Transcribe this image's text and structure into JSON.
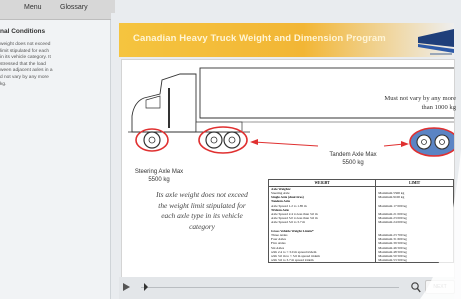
{
  "nav": {
    "tabs": [
      "Menu",
      "Glossary"
    ]
  },
  "sidebar": {
    "title": "nal Conditions",
    "lines": [
      "weight does not exceed",
      "limit stipulated for each",
      "in its vehicle category. It",
      "stressed that the load",
      "ween adjacent axles in a",
      "d not vary by any more",
      "kg."
    ]
  },
  "banner": {
    "title": "Canadian Heavy Truck Weight and Dimension Program"
  },
  "slide": {
    "callout_right": [
      "Must not vary by any more",
      "than 1000 kg"
    ],
    "tandem_label": [
      "Tandem Axle Max",
      "5500 kg"
    ],
    "steer_label": [
      "Steering Axle Max",
      "5500 kg"
    ],
    "body_note": [
      "Its axle weight does not exceed",
      "the weight limit stipulated for",
      "each axle type in its vehicle",
      "category"
    ],
    "table": {
      "headers": [
        "WEIGHT",
        "LIMIT"
      ],
      "rows": [
        [
          "Axle Weights:",
          ""
        ],
        [
          "Steering Axle",
          "Maximum 5500 kg"
        ],
        [
          "Single Axle (dual tires)",
          "Maximum 9100 kg"
        ],
        [
          "Tandem Axle",
          ""
        ],
        [
          "Axle Spread 1.2 to 1.85 m",
          "Maximum 17 000 kg"
        ],
        [
          "Tridem Axle",
          ""
        ],
        [
          "Axle Spread 2.4 to less than 3.0 m",
          "Maximum 21 000 kg"
        ],
        [
          "Axle Spread 3.0 to less than 3.6 m",
          "Maximum 23 000 kg"
        ],
        [
          "Axle Spread 3.6 to 3.7 m",
          "Maximum 24 000 kg"
        ],
        [
          "",
          ""
        ],
        [
          "Gross Vehicle Weight Limits*",
          ""
        ],
        [
          "Three Axles",
          "Maximum 23 700 kg"
        ],
        [
          "Four Axles",
          "Maximum 31 600 kg"
        ],
        [
          "Five Axles",
          "Maximum 39 500 kg"
        ],
        [
          "Six Axles",
          "Maximum 46 500 kg"
        ],
        [
          "     with 2.4 to < 3.0 m spread tridem",
          "Maximum 48 500 kg"
        ],
        [
          "     with 3.0 m to < 3.6 m spread tridem",
          "Maximum 50 500 kg"
        ],
        [
          "     with 3.6 to 3.7 m spread tridem",
          "Maximum 53 500 kg"
        ]
      ]
    }
  },
  "player": {
    "next_label": "NEXT"
  },
  "icons": {
    "logo": "truck-logo-icon",
    "play": "play-icon",
    "speaker": "speaker-icon"
  },
  "colors": {
    "banner_accent": "#f2b635",
    "highlight_ring": "#e03030",
    "highlight_fill": "#5b84c4"
  }
}
